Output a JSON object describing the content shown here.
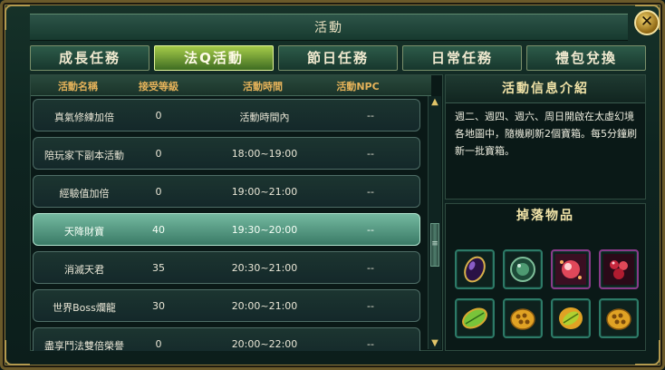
{
  "window": {
    "title": "活動",
    "close_icon": "close-icon"
  },
  "tabs": [
    {
      "label": "成長任務",
      "active": false
    },
    {
      "label": "法Q活動",
      "active": true
    },
    {
      "label": "節日任務",
      "active": false
    },
    {
      "label": "日常任務",
      "active": false
    },
    {
      "label": "禮包兌換",
      "active": false
    }
  ],
  "activity_table": {
    "headers": [
      "活動名稱",
      "接受等級",
      "活動時間",
      "活動NPC"
    ],
    "rows": [
      {
        "name": "真氣修練加倍",
        "level": "0",
        "time": "活動時間內",
        "npc": "--",
        "selected": false
      },
      {
        "name": "陪玩家下副本活動",
        "level": "0",
        "time": "18:00~19:00",
        "npc": "--",
        "selected": false
      },
      {
        "name": "經驗值加倍",
        "level": "0",
        "time": "19:00~21:00",
        "npc": "--",
        "selected": false
      },
      {
        "name": "天降財寶",
        "level": "40",
        "time": "19:30~20:00",
        "npc": "--",
        "selected": true
      },
      {
        "name": "消滅天君",
        "level": "35",
        "time": "20:30~21:00",
        "npc": "--",
        "selected": false
      },
      {
        "name": "世界Boss爛龍",
        "level": "30",
        "time": "20:00~21:00",
        "npc": "--",
        "selected": false
      },
      {
        "name": "盡享鬥法雙倍榮譽",
        "level": "0",
        "time": "20:00~22:00",
        "npc": "--",
        "selected": false
      }
    ]
  },
  "activity_info": {
    "title": "活動信息介紹",
    "text": "週二、週四、週六、周日開啟在太虛幻境各地圖中，隨機刷新2個寶箱。每5分鐘刷新一批寶箱。"
  },
  "drop_items": {
    "title": "掉落物品",
    "items": [
      {
        "icon": "dark-gem-icon",
        "color": "#5a2a8a"
      },
      {
        "icon": "jade-orb-icon",
        "color": "#4e9a72"
      },
      {
        "icon": "red-spark-orb-icon",
        "color": "#e0485a"
      },
      {
        "icon": "ruby-cluster-icon",
        "color": "#c8283e"
      },
      {
        "icon": "green-leaf-gem-icon",
        "color": "#79c43a"
      },
      {
        "icon": "gold-nugget-icon",
        "color": "#e0a224"
      },
      {
        "icon": "green-gold-gem-icon",
        "color": "#b0d030"
      },
      {
        "icon": "gold-nugget-icon",
        "color": "#e0a224"
      }
    ]
  },
  "scrollbar": {
    "up_icon": "▲",
    "down_icon": "▼",
    "thumb_icon": "≡"
  }
}
